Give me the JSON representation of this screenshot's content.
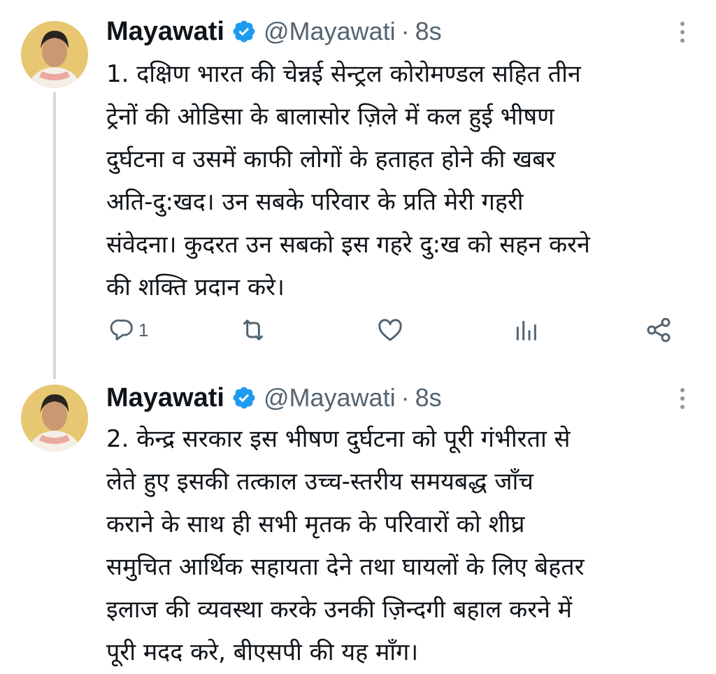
{
  "tweets": [
    {
      "author_name": "Mayawati",
      "handle": "@Mayawati",
      "separator": "·",
      "time": "8s",
      "lines": [
        "1. दक्षिण भारत की चेन्नई सेन्ट्रल कोरोमण्डल सहित तीन",
        "ट्रेनों की ओडिसा के बालासोर ज़िले में कल हुई भीषण",
        "दुर्घटना व उसमें काफी लोगों के हताहत होने की खबर",
        "अति-दु:खद। उन सबके परिवार के प्रति मेरी गहरी",
        "संवेदना। कुदरत उन सबको इस गहरे दु:ख को सहन करने",
        "की शक्ति प्रदान करे।"
      ],
      "reply_count": "1"
    },
    {
      "author_name": "Mayawati",
      "handle": "@Mayawati",
      "separator": "·",
      "time": "8s",
      "lines": [
        "2. केन्द्र सरकार इस भीषण दुर्घटना को पूरी गंभीरता से",
        "लेते हुए इसकी तत्काल उच्च-स्तरीय समयबद्ध जाँच",
        "कराने के साथ ही सभी मृतक के परिवारों को शीघ्र",
        "समुचित आर्थिक सहायता देने तथा घायलों के लिए बेहतर",
        "इलाज की व्यवस्था करके उनकी ज़िन्दगी बहाल करने में",
        "पूरी मदद करे, बीएसपी की यह माँग।"
      ]
    }
  ],
  "icons": {
    "verified": "verified-badge-icon",
    "more": "more-vertical-icon",
    "reply": "reply-icon",
    "retweet": "retweet-icon",
    "like": "like-icon",
    "views": "views-icon",
    "share": "share-icon"
  },
  "colors": {
    "verified_blue": "#1d9bf0",
    "secondary_text": "#536471",
    "primary_text": "#0f1419",
    "thread_line": "#cfd9de",
    "avatar_bg": "#e8c772"
  }
}
